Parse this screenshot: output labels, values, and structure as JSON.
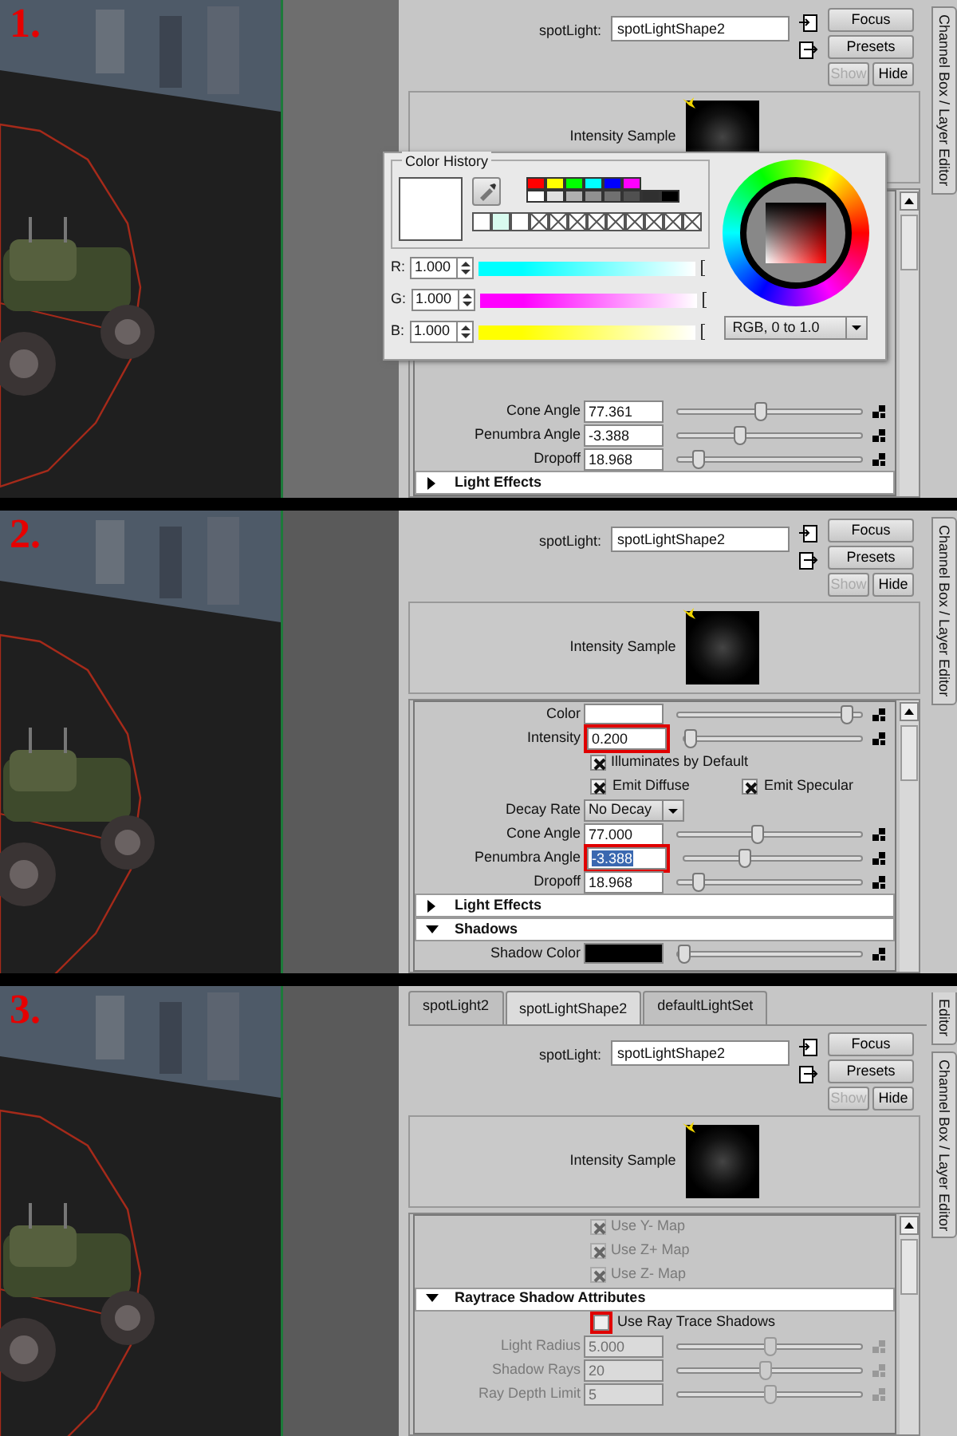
{
  "panels": [
    {
      "step": "1.",
      "side_tabs": [
        "Channel Box / Layer Editor"
      ],
      "node_label": "spotLight:",
      "node_name": "spotLightShape2",
      "buttons": [
        {
          "label": "Focus",
          "disabled": false
        },
        {
          "label": "Presets",
          "disabled": false
        },
        {
          "label": "Show",
          "disabled": true
        },
        {
          "label": "Hide",
          "disabled": false
        }
      ],
      "sample_label": "Intensity Sample",
      "rows": [
        {
          "kind": "slider",
          "label": "Cone Angle",
          "value": "77.361",
          "level": 0.45,
          "disabled": false,
          "highlighted": false,
          "text_selected": false
        },
        {
          "kind": "slider",
          "label": "Penumbra Angle",
          "value": "-3.388",
          "level": 0.33,
          "disabled": false,
          "highlighted": false,
          "text_selected": false
        },
        {
          "kind": "slider",
          "label": "Dropoff",
          "value": "18.968",
          "level": 0.08,
          "disabled": false,
          "highlighted": false,
          "text_selected": false
        },
        {
          "kind": "section",
          "label": "Light Effects",
          "expanded": false
        }
      ],
      "popup": {
        "title": "Color History",
        "current_swatch": {
          "color": "#ffffff"
        },
        "palette": [
          {
            "color": "#ff0000"
          },
          {
            "color": "#ffff00"
          },
          {
            "color": "#00ff00"
          },
          {
            "color": "#00ffff"
          },
          {
            "color": "#0000ff"
          },
          {
            "color": "#ff00ff"
          },
          {
            "color": "#ffffff"
          },
          {
            "color": "#e0e0e0"
          },
          {
            "color": "#b0b0b0"
          },
          {
            "color": "#909090"
          },
          {
            "color": "#707070"
          },
          {
            "color": "#505050"
          },
          {
            "color": "#303030"
          },
          {
            "color": "#000000"
          }
        ],
        "history": [
          {
            "kind": "color",
            "color": "#ffffff"
          },
          {
            "kind": "color",
            "color": "#d8fbef"
          },
          {
            "kind": "color",
            "color": "#ffffff"
          },
          {
            "kind": "empty"
          },
          {
            "kind": "empty"
          },
          {
            "kind": "empty"
          },
          {
            "kind": "empty"
          },
          {
            "kind": "empty"
          },
          {
            "kind": "empty"
          },
          {
            "kind": "empty"
          },
          {
            "kind": "empty"
          },
          {
            "kind": "empty"
          }
        ],
        "channels": [
          {
            "label": "R:",
            "value": "1.000",
            "color": "#00ffff"
          },
          {
            "label": "G:",
            "value": "1.000",
            "color": "#ff00ff"
          },
          {
            "label": "B:",
            "value": "1.000",
            "color": "#ffff00"
          }
        ],
        "mode": "RGB, 0 to 1.0"
      }
    },
    {
      "step": "2.",
      "side_tabs": [
        "Channel Box / Layer Editor"
      ],
      "node_label": "spotLight:",
      "node_name": "spotLightShape2",
      "buttons": [
        {
          "label": "Focus",
          "disabled": false
        },
        {
          "label": "Presets",
          "disabled": false
        },
        {
          "label": "Show",
          "disabled": true
        },
        {
          "label": "Hide",
          "disabled": false
        }
      ],
      "sample_label": "Intensity Sample",
      "rows": [
        {
          "kind": "swatch",
          "label": "Color",
          "color": "#ffffff",
          "level": 0.95
        },
        {
          "kind": "slider",
          "label": "Intensity",
          "value": "0.200",
          "level": 0.0,
          "disabled": false,
          "highlighted": true,
          "text_selected": false
        },
        {
          "kind": "checkbox",
          "label": "Illuminates by Default",
          "checked": true,
          "disabled": false,
          "highlighted": false
        },
        {
          "kind": "checkpair",
          "items": [
            {
              "label": "Emit Diffuse",
              "checked": true
            },
            {
              "label": "Emit Specular",
              "checked": true
            }
          ]
        },
        {
          "kind": "dropdown",
          "label": "Decay Rate",
          "value": "No Decay"
        },
        {
          "kind": "slider",
          "label": "Cone Angle",
          "value": "77.000",
          "level": 0.43,
          "disabled": false,
          "highlighted": false,
          "text_selected": false
        },
        {
          "kind": "slider",
          "label": "Penumbra Angle",
          "value": "-3.388",
          "level": 0.33,
          "disabled": false,
          "highlighted": true,
          "text_selected": true
        },
        {
          "kind": "slider",
          "label": "Dropoff",
          "value": "18.968",
          "level": 0.08,
          "disabled": false,
          "highlighted": false,
          "text_selected": false
        },
        {
          "kind": "section",
          "label": "Light Effects",
          "expanded": false
        },
        {
          "kind": "section",
          "label": "Shadows",
          "expanded": true
        },
        {
          "kind": "swatch",
          "label": "Shadow Color",
          "color": "#000000",
          "level": 0.0
        }
      ]
    },
    {
      "step": "3.",
      "tabs": [
        {
          "label": "spotLight2",
          "selected": false
        },
        {
          "label": "spotLightShape2",
          "selected": true
        },
        {
          "label": "defaultLightSet",
          "selected": false
        }
      ],
      "side_tabs": [
        "Editor",
        "Channel Box / Layer Editor"
      ],
      "node_label": "spotLight:",
      "node_name": "spotLightShape2",
      "buttons": [
        {
          "label": "Focus",
          "disabled": false
        },
        {
          "label": "Presets",
          "disabled": false
        },
        {
          "label": "Show",
          "disabled": true
        },
        {
          "label": "Hide",
          "disabled": false
        }
      ],
      "sample_label": "Intensity Sample",
      "rows": [
        {
          "kind": "checkbox",
          "label": "Use Y- Map",
          "checked": true,
          "disabled": true,
          "highlighted": false
        },
        {
          "kind": "checkbox",
          "label": "Use Z+ Map",
          "checked": true,
          "disabled": true,
          "highlighted": false
        },
        {
          "kind": "checkbox",
          "label": "Use Z- Map",
          "checked": true,
          "disabled": true,
          "highlighted": false
        },
        {
          "kind": "section",
          "label": "Raytrace Shadow Attributes",
          "expanded": true
        },
        {
          "kind": "checkbox",
          "label": "Use Ray Trace Shadows",
          "checked": false,
          "disabled": false,
          "highlighted": true
        },
        {
          "kind": "slider",
          "label": "Light Radius",
          "value": "5.000",
          "level": 0.5,
          "disabled": true,
          "highlighted": false,
          "text_selected": false
        },
        {
          "kind": "slider",
          "label": "Shadow Rays",
          "value": "20",
          "level": 0.48,
          "disabled": true,
          "highlighted": false,
          "text_selected": false
        },
        {
          "kind": "slider",
          "label": "Ray Depth Limit",
          "value": "5",
          "level": 0.5,
          "disabled": true,
          "highlighted": false,
          "text_selected": false
        }
      ]
    }
  ]
}
